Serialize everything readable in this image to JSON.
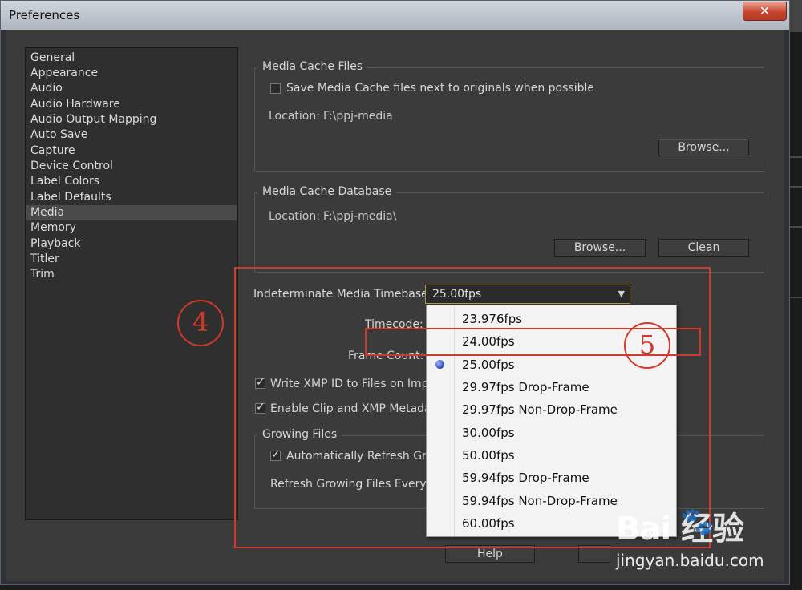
{
  "window": {
    "title": "Preferences",
    "close_symbol": "✕"
  },
  "sidebar": {
    "items": [
      {
        "label": "General"
      },
      {
        "label": "Appearance"
      },
      {
        "label": "Audio"
      },
      {
        "label": "Audio Hardware"
      },
      {
        "label": "Audio Output Mapping"
      },
      {
        "label": "Auto Save"
      },
      {
        "label": "Capture"
      },
      {
        "label": "Device Control"
      },
      {
        "label": "Label Colors"
      },
      {
        "label": "Label Defaults"
      },
      {
        "label": "Media",
        "selected": true
      },
      {
        "label": "Memory"
      },
      {
        "label": "Playback"
      },
      {
        "label": "Titler"
      },
      {
        "label": "Trim"
      }
    ]
  },
  "media_cache_files": {
    "title": "Media Cache Files",
    "save_next_label": "Save Media Cache files next to originals when possible",
    "save_next_checked": false,
    "location_label": "Location:",
    "location_value": "F:\\ppj-media",
    "browse_label": "Browse..."
  },
  "media_cache_database": {
    "title": "Media Cache Database",
    "location_label": "Location:",
    "location_value": "F:\\ppj-media\\",
    "browse_label": "Browse...",
    "clean_label": "Clean"
  },
  "timebase": {
    "label": "Indeterminate Media Timebase:",
    "selected": "25.00fps",
    "options": [
      "23.976fps",
      "24.00fps",
      "25.00fps",
      "29.97fps Drop-Frame",
      "29.97fps Non-Drop-Frame",
      "30.00fps",
      "50.00fps",
      "59.94fps Drop-Frame",
      "59.94fps Non-Drop-Frame",
      "60.00fps"
    ]
  },
  "timecode_label": "Timecode:",
  "frame_count_label": "Frame Count:",
  "write_xmp_label": "Write XMP ID to Files on Impo",
  "enable_clip_label": "Enable Clip and XMP Metadat",
  "growing_files": {
    "title": "Growing Files",
    "auto_refresh_label": "Automatically Refresh Grov",
    "refresh_every_label": "Refresh Growing Files Every"
  },
  "footer": {
    "help_label": "Help"
  },
  "annotations": {
    "step4": "4",
    "step5": "5"
  },
  "watermark": {
    "brand": "Bai  经验",
    "url": "jingyan.baidu.com"
  },
  "colors": {
    "annotation_red": "#d0392b",
    "dropdown_bg": "#f3f3f3",
    "dialog_bg": "#3b3b3b"
  }
}
